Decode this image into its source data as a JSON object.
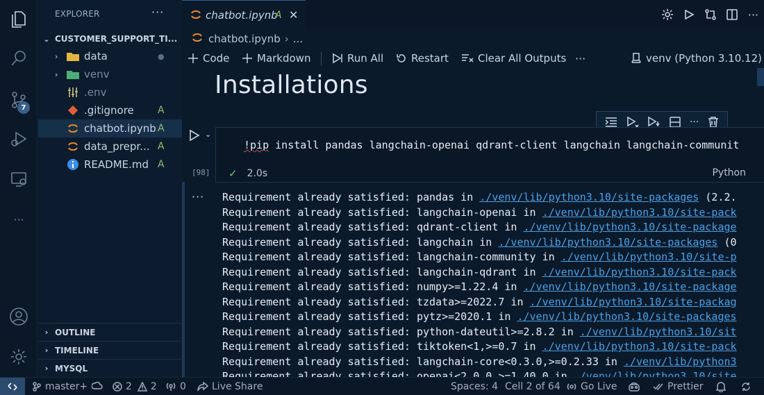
{
  "activity_bar": {
    "icons": [
      "explorer-icon",
      "search-icon",
      "source-control-icon",
      "run-debug-icon",
      "remote-explorer-icon",
      "more-icon",
      "accounts-icon",
      "manage-icon"
    ],
    "source_control_badge": "7"
  },
  "sidebar": {
    "title": "EXPLORER",
    "more": "···",
    "folder": "CUSTOMER_SUPPORT_TI...",
    "items": [
      {
        "label": "data",
        "status": "●",
        "icon": "folder-data-icon"
      },
      {
        "label": "venv",
        "status": "",
        "icon": "folder-venv-icon"
      },
      {
        "label": ".env",
        "status": "",
        "icon": "env-file-icon"
      },
      {
        "label": ".gitignore",
        "status": "A",
        "icon": "git-icon"
      },
      {
        "label": "chatbot.ipynb",
        "status": "A",
        "icon": "jupyter-icon"
      },
      {
        "label": "data_prepr...",
        "status": "A",
        "icon": "jupyter-icon"
      },
      {
        "label": "README.md",
        "status": "A",
        "icon": "info-icon"
      }
    ],
    "sections": [
      "OUTLINE",
      "TIMELINE",
      "MYSQL"
    ]
  },
  "tab": {
    "label": "chatbot.ipynb",
    "status": "A",
    "close": "✕"
  },
  "breadcrumb": {
    "file": "chatbot.ipynb",
    "rest": "..."
  },
  "toolbar": {
    "code": "Code",
    "markdown": "Markdown",
    "run_all": "Run All",
    "restart": "Restart",
    "clear_outputs": "Clear All Outputs",
    "more": "···",
    "kernel": "venv (Python 3.10.12)"
  },
  "notebook": {
    "heading": "Installations",
    "cell": {
      "code_cmd": "!pip",
      "code_rest": " install pandas langchain-openai qdrant-client langchain langchain-communit",
      "exec_count": "[98]",
      "duration": "2.0s",
      "language": "Python"
    },
    "output_more": "···",
    "output": [
      {
        "pre": "Requirement already satisfied: pandas in ",
        "link": "./venv/lib/python3.10/site-packages",
        "post": " (2.2."
      },
      {
        "pre": "Requirement already satisfied: langchain-openai in ",
        "link": "./venv/lib/python3.10/site-pack",
        "post": ""
      },
      {
        "pre": "Requirement already satisfied: qdrant-client in ",
        "link": "./venv/lib/python3.10/site-package",
        "post": ""
      },
      {
        "pre": "Requirement already satisfied: langchain in ",
        "link": "./venv/lib/python3.10/site-packages",
        "post": " (0"
      },
      {
        "pre": "Requirement already satisfied: langchain-community in ",
        "link": "./venv/lib/python3.10/site-p",
        "post": ""
      },
      {
        "pre": "Requirement already satisfied: langchain-qdrant in ",
        "link": "./venv/lib/python3.10/site-pack",
        "post": ""
      },
      {
        "pre": "Requirement already satisfied: numpy>=1.22.4 in ",
        "link": "./venv/lib/python3.10/site-package",
        "post": ""
      },
      {
        "pre": "Requirement already satisfied: tzdata>=2022.7 in ",
        "link": "./venv/lib/python3.10/site-packag",
        "post": ""
      },
      {
        "pre": "Requirement already satisfied: pytz>=2020.1 in ",
        "link": "./venv/lib/python3.10/site-packages",
        "post": ""
      },
      {
        "pre": "Requirement already satisfied: python-dateutil>=2.8.2 in ",
        "link": "./venv/lib/python3.10/sit",
        "post": ""
      },
      {
        "pre": "Requirement already satisfied: tiktoken<1,>=0.7 in ",
        "link": "./venv/lib/python3.10/site-pack",
        "post": ""
      },
      {
        "pre": "Requirement already satisfied: langchain-core<0.3.0,>=0.2.33 in ",
        "link": "./venv/lib/python3",
        "post": ""
      },
      {
        "pre": "Requirement already satisfied: openai<2.0.0,>=1.40.0 in ",
        "link": "./venv/lib/python3.10/site",
        "post": ""
      }
    ]
  },
  "statusbar": {
    "branch": "master+",
    "errors": "2",
    "warnings": "2",
    "ports": "0",
    "live_share": "Live Share",
    "spaces": "Spaces: 4",
    "cell": "Cell 2 of 64",
    "go_live": "Go Live",
    "prettier": "Prettier"
  }
}
